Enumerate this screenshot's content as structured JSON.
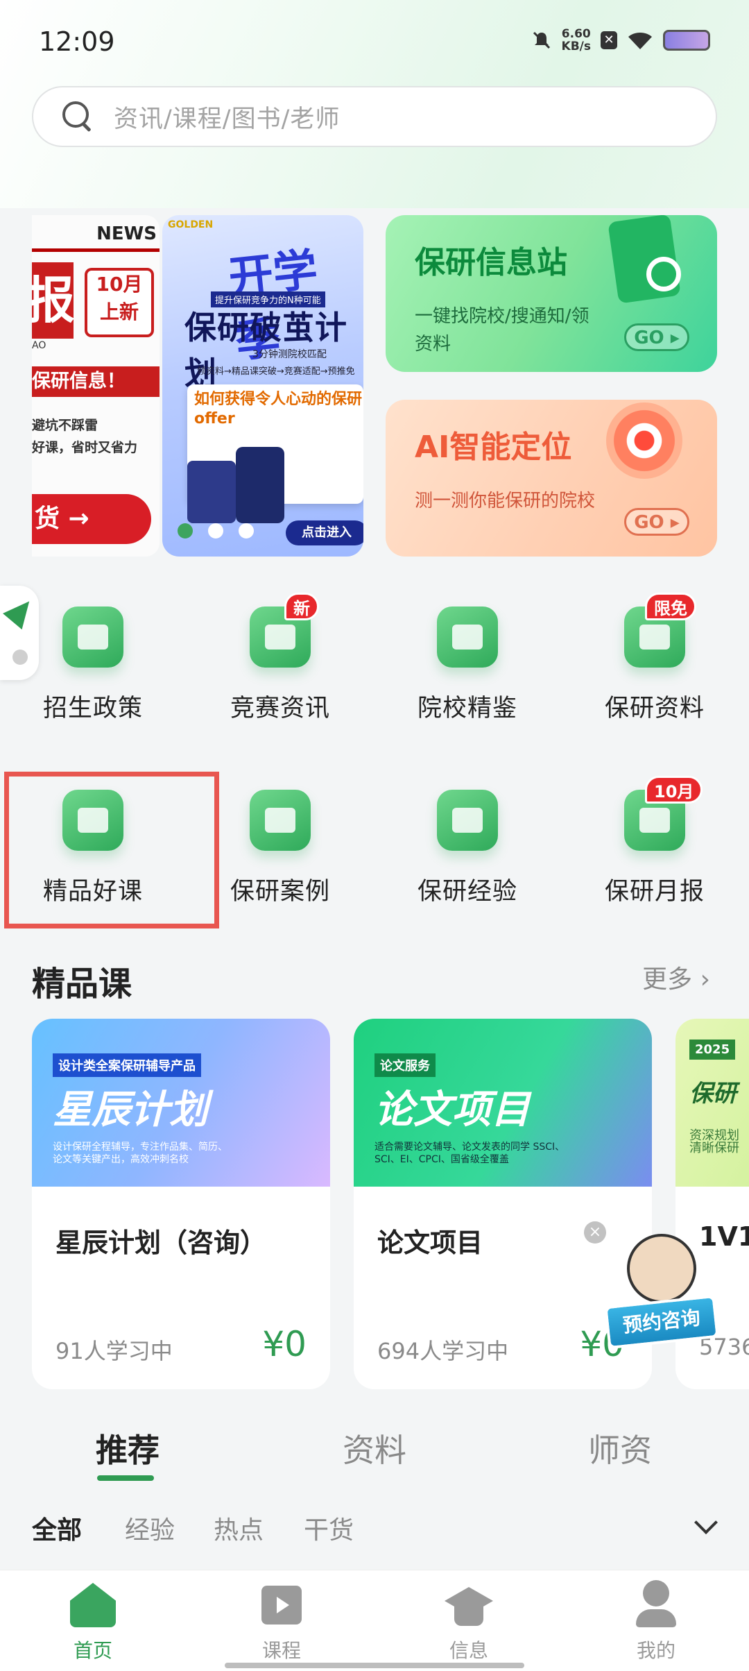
{
  "status": {
    "time": "12:09",
    "speed_value": "6.60",
    "speed_unit": "KB/s"
  },
  "search": {
    "placeholder": "资讯/课程/图书/老师"
  },
  "banners": {
    "news_label": "NEWS",
    "news_cal_month": "10月",
    "news_cal_text": "上新",
    "news_big_char": "报",
    "news_sub": "AO",
    "news_red_text": "保研信息！",
    "news_line1": "避坑不踩雷",
    "news_line2": "好课，省时又省力",
    "news_cta": "货 →",
    "main_brand": "GOLDEN",
    "main_big": "开学季",
    "main_tag": "提升保研竞争力的N种可能",
    "main_title": "保研破茧计划",
    "main_line1": "3分钟测院校匹配",
    "main_line2": "领资料→精品课突破→竞赛适配→预推免",
    "main_screen_title": "如何获得令人心动的保研offer",
    "main_enter": "点击进入",
    "station_title": "保研信息站",
    "station_desc": "一键找院校/搜通知/领资料",
    "station_go": "GO",
    "ai_title": "AI智能定位",
    "ai_desc": "测一测你能保研的院校",
    "ai_go": "GO"
  },
  "grid": [
    {
      "label": "招生政策",
      "badge": ""
    },
    {
      "label": "竞赛资讯",
      "badge": "新"
    },
    {
      "label": "院校精鉴",
      "badge": ""
    },
    {
      "label": "保研资料",
      "badge": "限免"
    },
    {
      "label": "精品好课",
      "badge": ""
    },
    {
      "label": "保研案例",
      "badge": ""
    },
    {
      "label": "保研经验",
      "badge": ""
    },
    {
      "label": "保研月报",
      "badge": "10月"
    }
  ],
  "section": {
    "title": "精品课",
    "more": "更多 ›"
  },
  "courses": [
    {
      "name": "星辰计划（咨询）",
      "learners": "91人学习中",
      "price": "¥0",
      "tag": "设计类全案保研辅导产品",
      "banner_big": "星辰计划",
      "banner_small": "设计保研全程辅导，专注作品集、简历、论文等关键产出，高效冲刺名校"
    },
    {
      "name": "论文项目",
      "learners": "694人学习中",
      "price": "¥0",
      "tag": "论文服务",
      "banner_big": "论文项目",
      "banner_small": "适合需要论文辅导、论文发表的同学 SSCI、SCI、EI、CPCI、国省级全覆盖"
    },
    {
      "name": "1V1",
      "learners": "5736",
      "price": "",
      "tag": "2025",
      "banner_big": "保研",
      "banner_small": "资深规划 清晰保研"
    }
  ],
  "mascot": {
    "button": "预约咨询"
  },
  "tabs": [
    "推荐",
    "资料",
    "师资"
  ],
  "subtabs": [
    "全部",
    "经验",
    "热点",
    "干货"
  ],
  "bottom_nav": [
    "首页",
    "课程",
    "信息",
    "我的"
  ],
  "colors": {
    "accent": "#2f9b52",
    "badge": "#e8282c",
    "highlight": "#e85650"
  }
}
